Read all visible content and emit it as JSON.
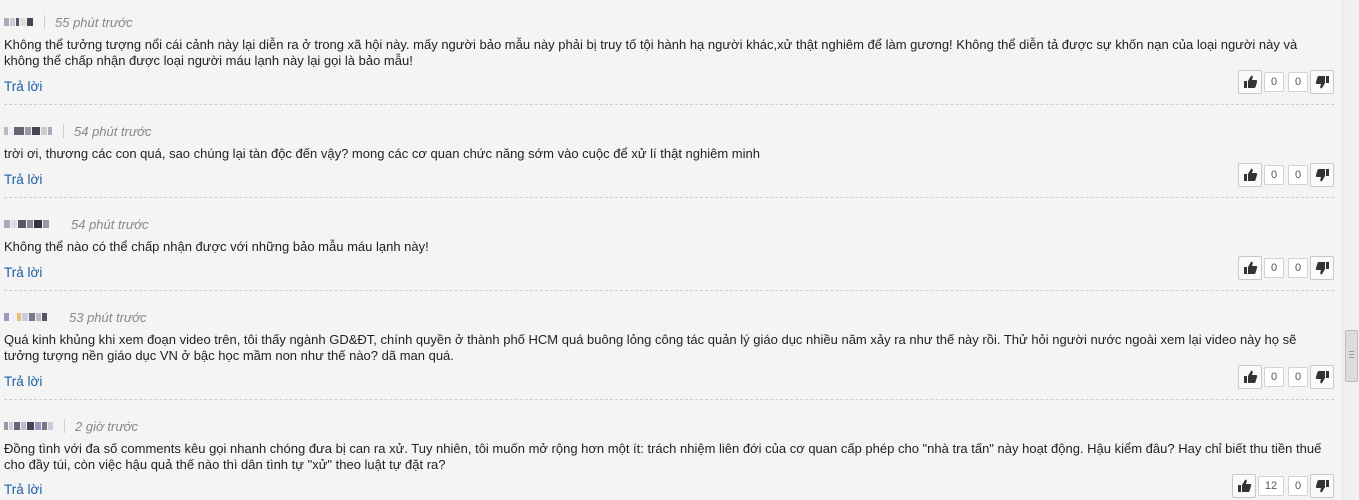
{
  "comments": [
    {
      "time": "55 phút trước",
      "text": "Không thể tưởng tượng nổi cái cảnh này lại diễn ra ở trong xã hội này. mấy người bảo mẫu này phải bị truy tố tội hành hạ người khác,xử thật nghiêm để làm gương! Không thể diễn tả được sự khốn nạn của loại người này và không thể chấp nhận được loại người máu lạnh này lại gọi là bảo mẫu!",
      "reply": "Trả lời",
      "likes": "0",
      "dislikes": "0"
    },
    {
      "time": "54 phút trước",
      "text": "trời ơi, thương các con quá, sao chúng lại tàn độc đến vậy? mong các cơ quan chức năng sớm vào cuộc để xử lí thật nghiêm minh",
      "reply": "Trả lời",
      "likes": "0",
      "dislikes": "0"
    },
    {
      "time": "54 phút trước",
      "text": "Không thể nào có thể chấp nhận được với những bảo mẫu máu lạnh này!",
      "reply": "Trả lời",
      "likes": "0",
      "dislikes": "0"
    },
    {
      "time": "53 phút trước",
      "text": "Quá kinh khủng khi xem đoạn video trên, tôi thấy ngành GD&ĐT, chính quyền ở thành phố HCM quá buông lỏng công tác quản lý giáo dục nhiều năm xảy ra như thế này rồi. Thử hỏi người nước ngoài xem lại video này họ sẽ tưởng tượng nền giáo dục VN ở bậc học mầm non như thế nào? dã man quá.",
      "reply": "Trả lời",
      "likes": "0",
      "dislikes": "0"
    },
    {
      "time": "2 giờ trước",
      "text": "Đồng tình với đa số comments kêu gọi nhanh chóng đưa bị can ra xử. Tuy nhiên, tôi muốn mở rộng hơn một ít: trách nhiệm liên đới của cơ quan cấp phép cho \"nhà tra tấn\" này hoạt động. Hậu kiểm đâu? Hay chỉ biết thu tiền thuế cho đầy túi, còn việc hậu quả thế nào thì dân tình tự \"xử\" theo luật tự đặt ra?",
      "reply": "Trả lời",
      "likes": "12",
      "dislikes": "0"
    }
  ],
  "icons": {
    "like": "thumbs-up-icon",
    "dislike": "thumbs-down-icon"
  },
  "colors": {
    "link": "#1b5fa6",
    "background": "#f4f4f4",
    "time_text": "#888888"
  }
}
